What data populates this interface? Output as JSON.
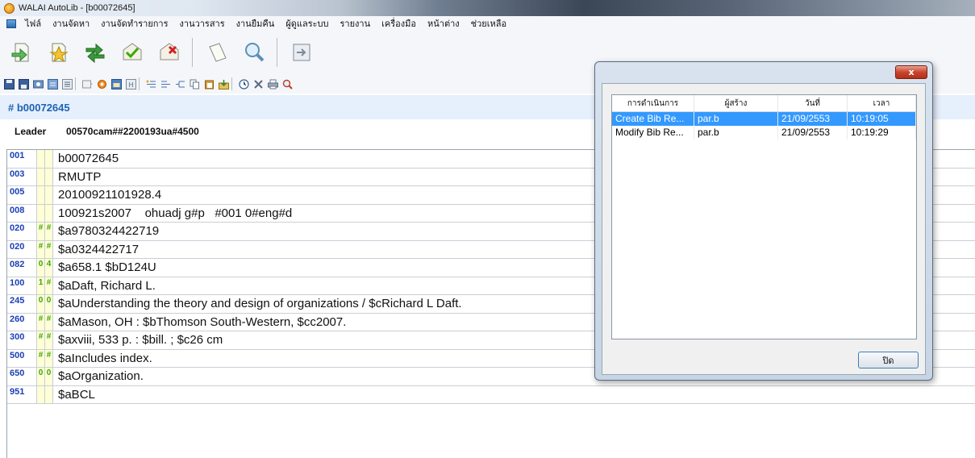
{
  "window": {
    "title": "WALAI AutoLib - [b00072645]"
  },
  "menu": [
    "ไฟล์",
    "งานจัดหา",
    "งานจัดทำรายการ",
    "งานวารสาร",
    "งานยืมคืน",
    "ผู้ดูแลระบบ",
    "รายงาน",
    "เครื่องมือ",
    "หน้าต่าง",
    "ช่วยเหลือ"
  ],
  "record": {
    "id_label": "# b00072645",
    "leader_label": "Leader",
    "leader_value": "00570cam##2200193ua#4500"
  },
  "marc_fields": [
    {
      "tag": "001",
      "ind1": "",
      "ind2": "",
      "value": "b00072645"
    },
    {
      "tag": "003",
      "ind1": "",
      "ind2": "",
      "value": "RMUTP"
    },
    {
      "tag": "005",
      "ind1": "",
      "ind2": "",
      "value": "20100921101928.4"
    },
    {
      "tag": "008",
      "ind1": "",
      "ind2": "",
      "value": "100921s2007    ohuadj g#p   #001 0#eng#d"
    },
    {
      "tag": "020",
      "ind1": "#",
      "ind2": "#",
      "value": "$a9780324422719"
    },
    {
      "tag": "020",
      "ind1": "#",
      "ind2": "#",
      "value": "$a0324422717"
    },
    {
      "tag": "082",
      "ind1": "0",
      "ind2": "4",
      "value": "$a658.1 $bD124U"
    },
    {
      "tag": "100",
      "ind1": "1",
      "ind2": "#",
      "value": "$aDaft, Richard L."
    },
    {
      "tag": "245",
      "ind1": "0",
      "ind2": "0",
      "value": "$aUnderstanding the theory and design of organizations / $cRichard L Daft."
    },
    {
      "tag": "260",
      "ind1": "#",
      "ind2": "#",
      "value": "$aMason, OH : $bThomson South-Western, $cc2007."
    },
    {
      "tag": "300",
      "ind1": "#",
      "ind2": "#",
      "value": "$axviii, 533 p. : $bill. ; $c26 cm"
    },
    {
      "tag": "500",
      "ind1": "#",
      "ind2": "#",
      "value": "$aIncludes index."
    },
    {
      "tag": "650",
      "ind1": "0",
      "ind2": "0",
      "value": "$aOrganization."
    },
    {
      "tag": "951",
      "ind1": "",
      "ind2": "",
      "value": "$aBCL"
    }
  ],
  "history_dialog": {
    "close_label": "x",
    "columns": [
      "การดำเนินการ",
      "ผู้สร้าง",
      "วันที่",
      "เวลา"
    ],
    "rows": [
      {
        "action": "Create Bib Re...",
        "creator": "par.b",
        "date": "21/09/2553",
        "time": "10:19:05",
        "selected": true
      },
      {
        "action": "Modify Bib Re...",
        "creator": "par.b",
        "date": "21/09/2553",
        "time": "10:19:29",
        "selected": false
      }
    ],
    "ok_label": "ปิด"
  },
  "colors": {
    "record_id": "#1d62b6",
    "tag_text": "#1a3fb8",
    "indicator_text": "#3aa800",
    "indicator_bg": "#ffffd7",
    "selected_row": "#3399ff"
  }
}
